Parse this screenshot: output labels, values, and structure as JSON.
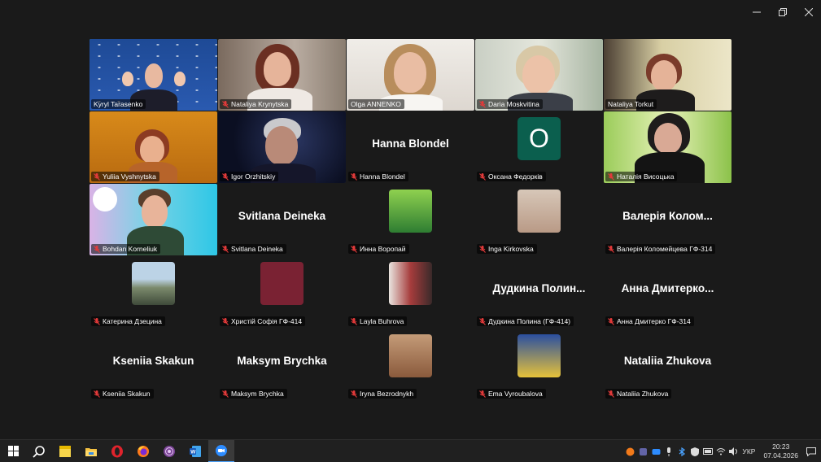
{
  "window_controls": [
    "minimize",
    "restore",
    "close"
  ],
  "participants": [
    {
      "name": "Kyryl Tarasenko",
      "type": "video",
      "muted": false,
      "active": true
    },
    {
      "name": "Nataliya Krynytska",
      "type": "video",
      "muted": true
    },
    {
      "name": "Olga ANNENKO",
      "type": "video",
      "muted": false
    },
    {
      "name": "Daria Moskvitina",
      "type": "video",
      "muted": true
    },
    {
      "name": "Nataliya Torkut",
      "type": "video",
      "muted": false
    },
    {
      "name": "Yuliia Vyshnytska",
      "type": "video",
      "muted": true
    },
    {
      "name": "Igor Orzhitskiy",
      "type": "video",
      "muted": true
    },
    {
      "name": "Hanna Blondel",
      "type": "name",
      "center": "Hanna Blondel",
      "muted": true
    },
    {
      "name": "Оксана Федорків",
      "type": "letter",
      "letter": "O",
      "muted": true
    },
    {
      "name": "Наталія Висоцька",
      "type": "video",
      "muted": true
    },
    {
      "name": "Bohdan Korneliuk",
      "type": "video",
      "muted": true
    },
    {
      "name": "Svitlana Deineka",
      "type": "name",
      "center": "Svitlana Deineka",
      "muted": true
    },
    {
      "name": "Инна Воропай",
      "type": "avatar",
      "muted": true
    },
    {
      "name": "Inga Kirkovska",
      "type": "avatar",
      "muted": true
    },
    {
      "name": "Валерія Коломейцева ГФ-314",
      "type": "name",
      "center": "Валерія Колом...",
      "muted": true
    },
    {
      "name": "Катерина Дзецина",
      "type": "avatar",
      "muted": true
    },
    {
      "name": "Христій Софія ГФ-414",
      "type": "avatar",
      "muted": true
    },
    {
      "name": "Layla Buhrova",
      "type": "avatar",
      "muted": true
    },
    {
      "name": "Дудкина Полина (ГФ-414)",
      "type": "name",
      "center": "Дудкина Полин...",
      "muted": true
    },
    {
      "name": "Анна Дмитерко ГФ-314",
      "type": "name",
      "center": "Анна Дмитерко...",
      "muted": true
    },
    {
      "name": "Kseniia Skakun",
      "type": "name",
      "center": "Kseniia Skakun",
      "muted": true
    },
    {
      "name": "Maksym Brychka",
      "type": "name",
      "center": "Maksym Brychka",
      "muted": true
    },
    {
      "name": "Iryna Bezrodnykh",
      "type": "avatar",
      "muted": true
    },
    {
      "name": "Ema Vyroubalova",
      "type": "avatar",
      "muted": true
    },
    {
      "name": "Nataliia Zhukova",
      "type": "name",
      "center": "Nataliia Zhukova",
      "muted": true
    }
  ],
  "taskbar": {
    "apps": [
      "windows-start-icon",
      "search-icon",
      "sticky-notes-icon",
      "file-explorer-icon",
      "opera-icon",
      "firefox-icon",
      "tor-browser-icon",
      "word-icon",
      "zoom-icon"
    ],
    "language": "УКР",
    "time": "20:23",
    "date": "07.04.2026"
  },
  "colors": {
    "active_border": "#23d18b",
    "mute_red": "#e23a3a",
    "letter_avatar": "#0b5f4e"
  }
}
